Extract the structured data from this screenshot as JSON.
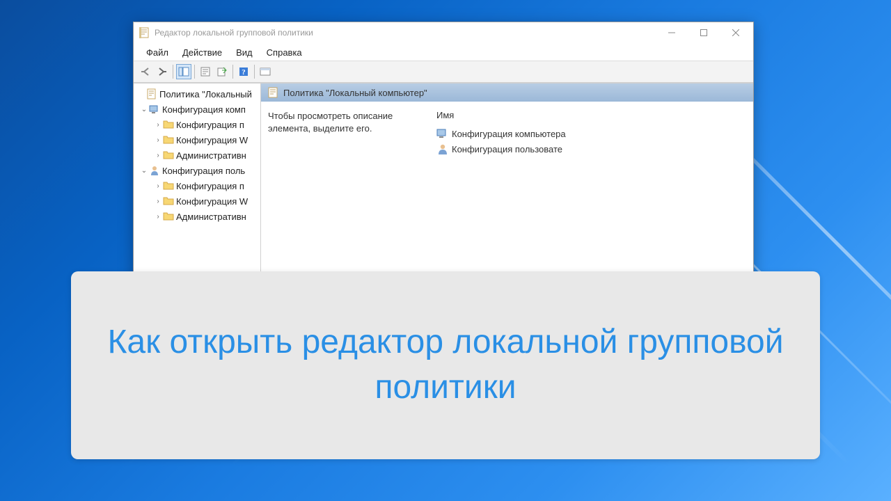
{
  "window_title": "Редактор локальной групповой политики",
  "menu": {
    "file": "Файл",
    "action": "Действие",
    "view": "Вид",
    "help": "Справка"
  },
  "tree": {
    "root": "Политика \"Локальный",
    "comp": "Конфигурация комп",
    "comp_soft": "Конфигурация п",
    "comp_win": "Конфигурация W",
    "comp_admin": "Административн",
    "user": "Конфигурация поль",
    "user_soft": "Конфигурация п",
    "user_win": "Конфигурация W",
    "user_admin": "Административн"
  },
  "detail": {
    "header": "Политика \"Локальный компьютер\"",
    "desc": "Чтобы просмотреть описание элемента, выделите его.",
    "col_name": "Имя",
    "item_comp": "Конфигурация компьютера",
    "item_user": "Конфигурация пользовате"
  },
  "overlay": "Как открыть редактор локальной групповой политики"
}
